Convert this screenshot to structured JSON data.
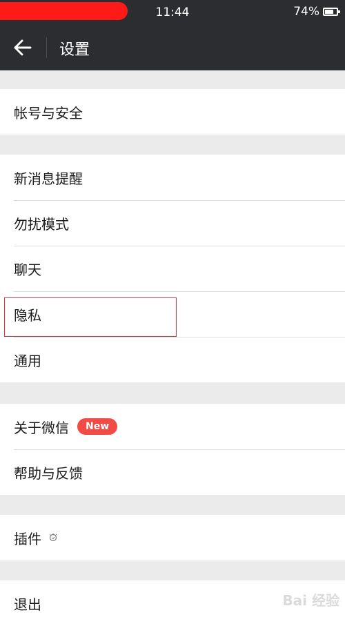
{
  "status_bar": {
    "time": "11:44",
    "battery": "74%",
    "battery_level": 0.74,
    "redaction_color": "#ff1a1a"
  },
  "header": {
    "back_icon": "arrow-left-icon",
    "title": "设置"
  },
  "groups": {
    "account": {
      "items": [
        {
          "label": "帐号与安全"
        }
      ]
    },
    "preferences": {
      "items": [
        {
          "label": "新消息提醒"
        },
        {
          "label": "勿扰模式"
        },
        {
          "label": "聊天"
        },
        {
          "label": "隐私"
        },
        {
          "label": "通用"
        }
      ]
    },
    "about": {
      "items": [
        {
          "label": "关于微信",
          "badge": "New"
        },
        {
          "label": "帮助与反馈"
        }
      ]
    },
    "plugins": {
      "items": [
        {
          "label": "插件",
          "icon": "lightbulb-icon"
        }
      ]
    },
    "logout": {
      "items": [
        {
          "label": "退出"
        }
      ]
    }
  },
  "annotation": {
    "highlight_color": "#e8303a",
    "target": "隐私"
  },
  "colors": {
    "bar_bg": "#2c2d30",
    "page_bg": "#ebebeb",
    "badge_bg": "#f24a45"
  }
}
